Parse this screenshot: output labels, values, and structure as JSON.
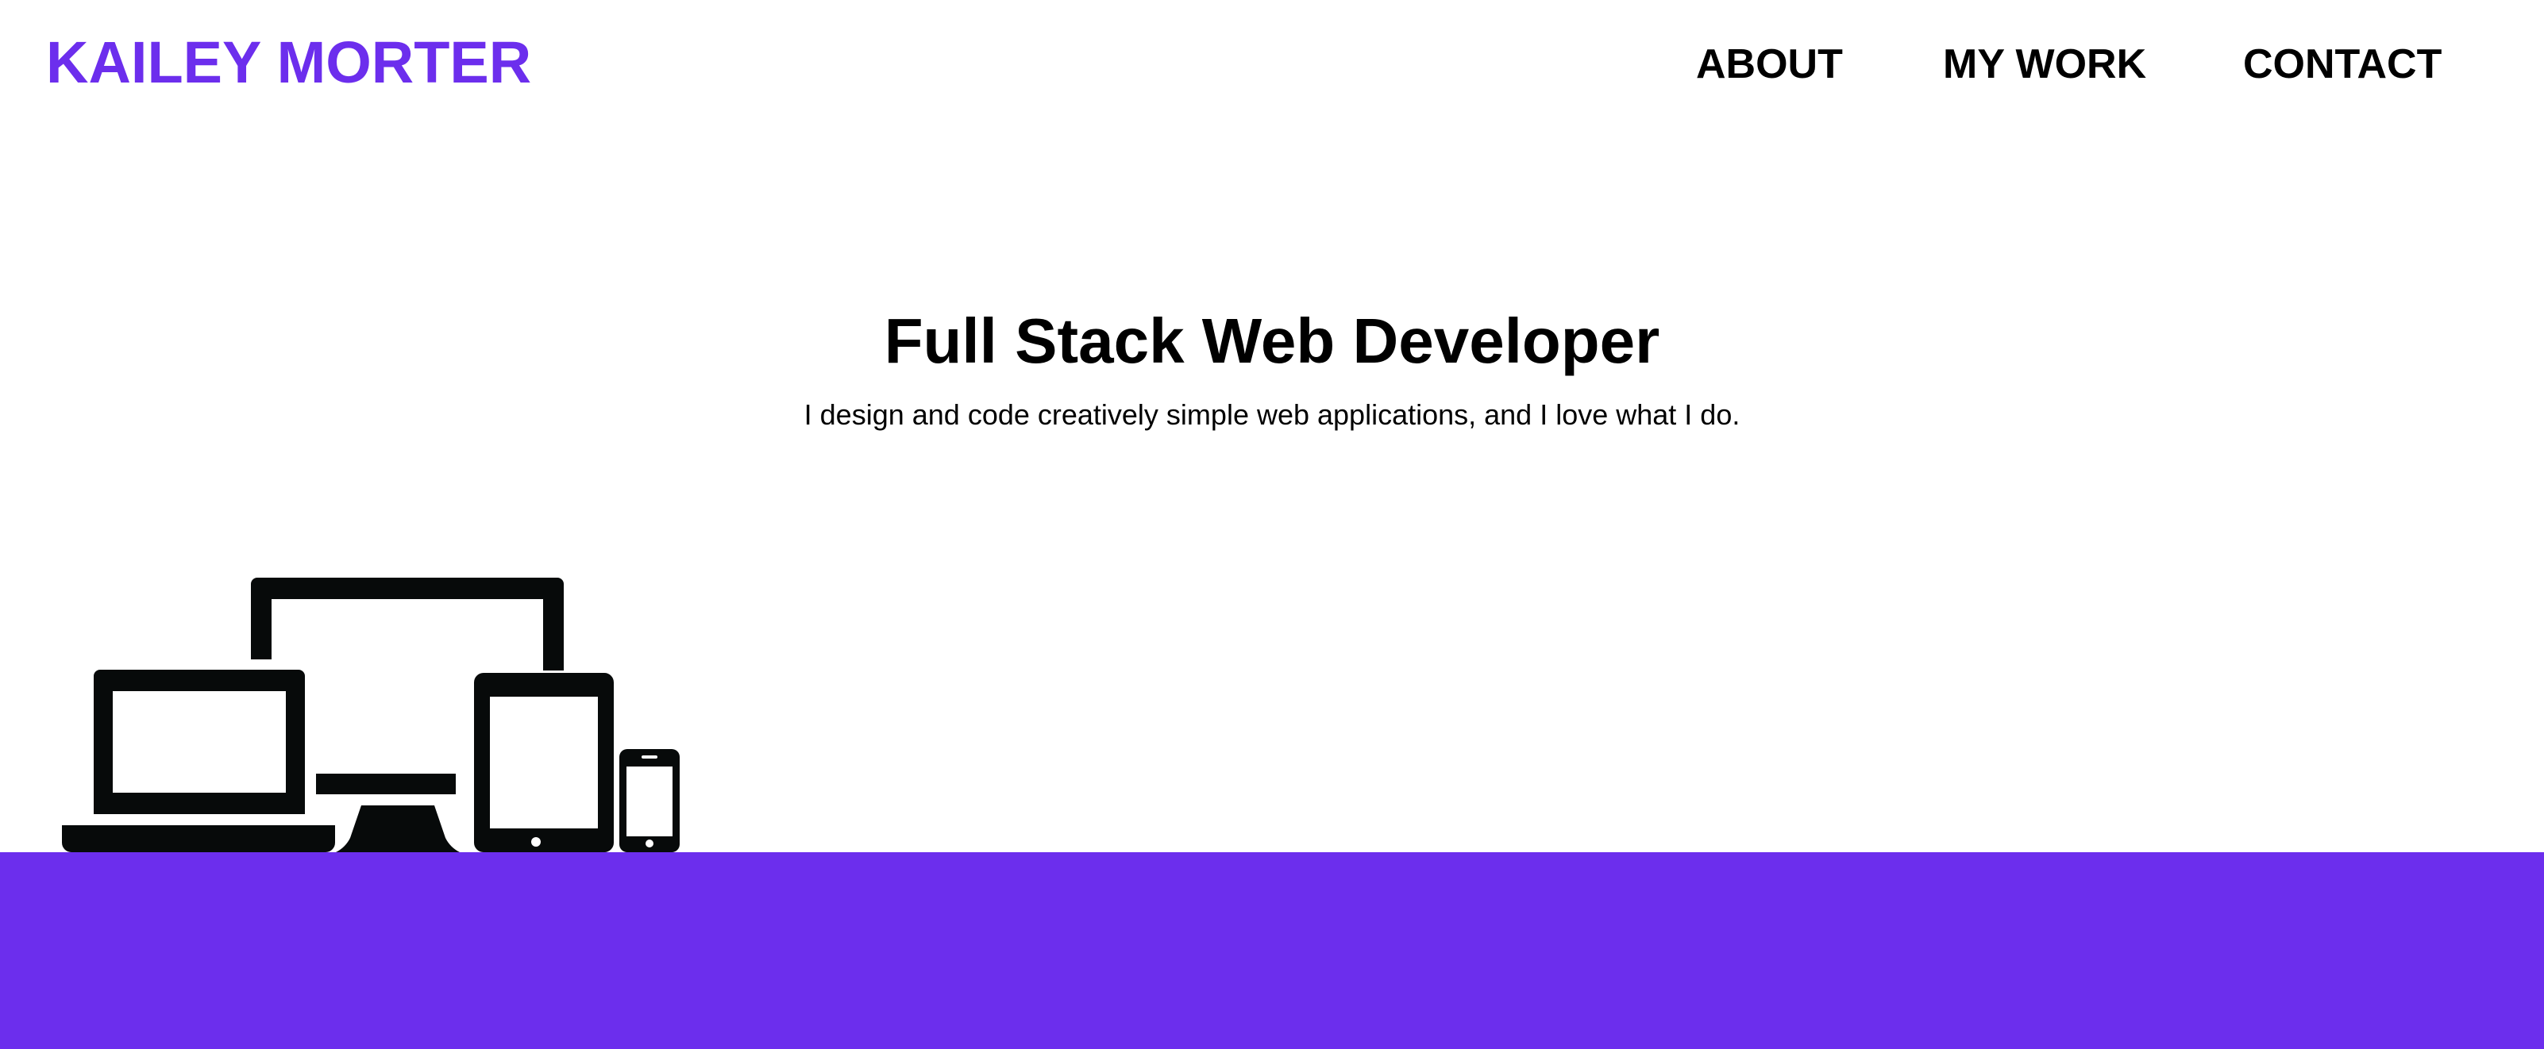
{
  "header": {
    "brand": "KAILEY MORTER",
    "nav": {
      "about": "ABOUT",
      "work": "MY WORK",
      "contact": "CONTACT"
    }
  },
  "hero": {
    "title": "Full Stack Web Developer",
    "subtitle": "I design and code creatively simple web applications, and I love what I do."
  },
  "illustration": {
    "icon": "responsive-devices-icon"
  },
  "colors": {
    "accent": "#6c2eed",
    "text": "#000000",
    "background": "#ffffff",
    "device_fill": "#070a0a"
  }
}
